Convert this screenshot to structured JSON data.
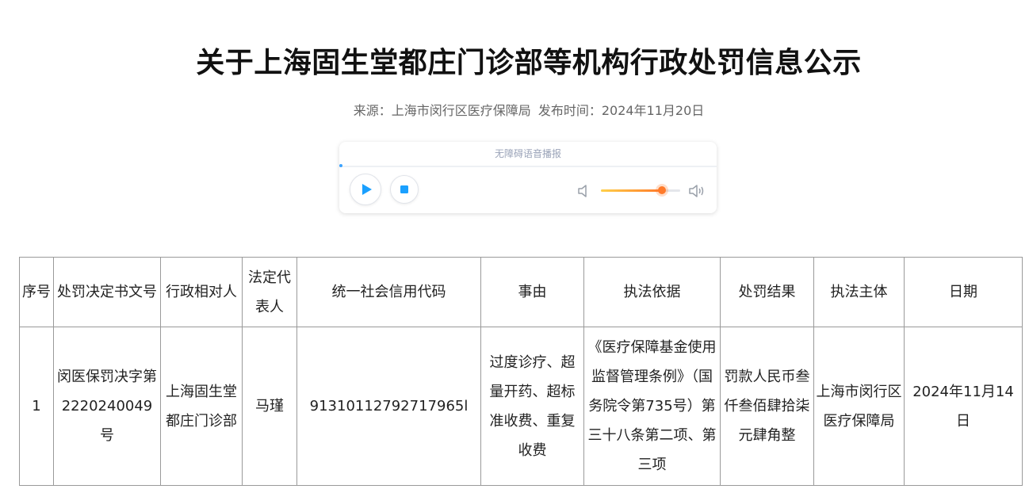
{
  "page": {
    "title": "关于上海固生堂都庄门诊部等机构行政处罚信息公示",
    "source_label": "来源：上海市闵行区医疗保障局",
    "publish_label": "发布时间：2024年11月20日"
  },
  "player": {
    "header": "无障碍语音播报",
    "play_icon": "play-icon",
    "stop_icon": "stop-icon",
    "volume_level": 0.77,
    "accent_color": "#3da3ff",
    "volume_color": "#ff7a2a"
  },
  "table": {
    "headers": [
      "序号",
      "处罚决定书文号",
      "行政相对人",
      "法定代表人",
      "统一社会信用代码",
      "事由",
      "执法依据",
      "处罚结果",
      "执法主体",
      "日期"
    ],
    "rows": [
      [
        "1",
        "闵医保罚决字第2220240049号",
        "上海固生堂都庄门诊部",
        "马瑾",
        "91310112792717965l",
        "过度诊疗、超量开药、超标准收费、重复收费",
        "《医疗保障基金使用监督管理条例》（国务院令第735号）第三十八条第二项、第三项",
        "罚款人民币叁仟叁佰肆拾柒元肆角整",
        "上海市闵行区医疗保障局",
        "2024年11月14日"
      ]
    ]
  }
}
